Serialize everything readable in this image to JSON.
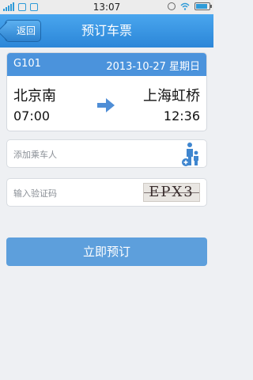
{
  "status_bar": {
    "time": "13:07"
  },
  "header": {
    "back_label": "返回",
    "title": "预订车票"
  },
  "train": {
    "number": "G101",
    "date": "2013-10-27 星期日",
    "from_station": "北京南",
    "to_station": "上海虹桥",
    "depart_time": "07:00",
    "arrive_time": "12:36"
  },
  "form": {
    "add_passenger_placeholder": "添加乘车人",
    "captcha_placeholder": "输入验证码",
    "captcha_text": "EPX3"
  },
  "submit_label": "立即预订",
  "colors": {
    "header": "#2b86d8",
    "card_head": "#4b93dc",
    "submit": "#5d9fdc",
    "background": "#eef0f3"
  }
}
